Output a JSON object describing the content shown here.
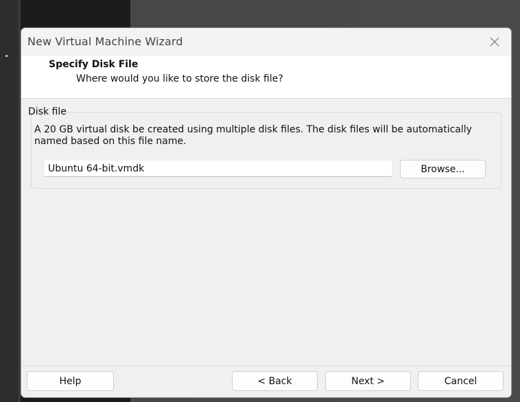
{
  "window": {
    "title": "New Virtual Machine Wizard"
  },
  "header": {
    "title": "Specify Disk File",
    "subtitle": "Where would you like to store the disk file?"
  },
  "disk_file": {
    "group_label": "Disk file",
    "description": "A 20 GB virtual disk be created using multiple disk files. The disk files will be automatically named based on this file name.",
    "file_name": "Ubuntu 64-bit.vmdk",
    "browse_label": "Browse..."
  },
  "footer": {
    "help_label": "Help",
    "back_label": "< Back",
    "next_label": "Next >",
    "cancel_label": "Cancel"
  },
  "icons": {
    "close": "close-icon"
  }
}
